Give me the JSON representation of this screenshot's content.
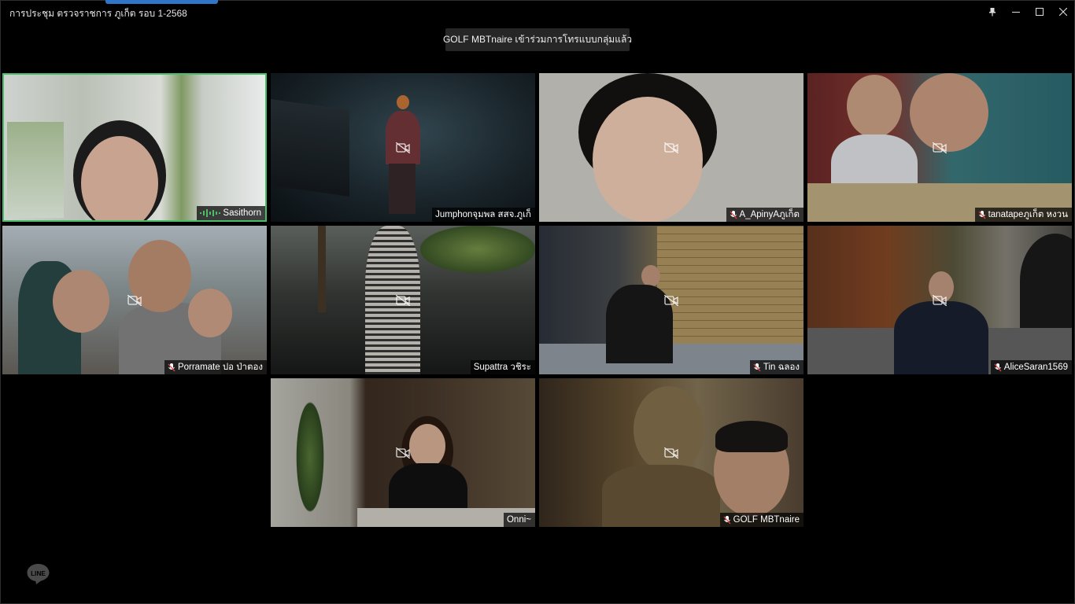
{
  "window": {
    "title": "การประชุม ตรวจราชการ ภูเก็ต รอบ 1-2568",
    "controls": [
      "pin-icon",
      "minimize-icon",
      "maximize-icon",
      "close-icon"
    ]
  },
  "notification": {
    "text": "GOLF MBTnaire เข้าร่วมการโทรแบบกลุ่มแล้ว"
  },
  "participants": [
    {
      "name": "Sasithorn",
      "speaking": true,
      "muted": false,
      "camera_icon": false
    },
    {
      "name": "Jumphonจุมพล สสจ.ภูเก็",
      "speaking": false,
      "muted": false,
      "camera_icon": true
    },
    {
      "name": "A_ApinyAภูเก็ต",
      "speaking": false,
      "muted": true,
      "camera_icon": true
    },
    {
      "name": "tanatapeภูเก็ต หงวน",
      "speaking": false,
      "muted": true,
      "camera_icon": true
    },
    {
      "name": "Porramate ปอ ป่าตอง",
      "speaking": false,
      "muted": true,
      "camera_icon": true
    },
    {
      "name": "Supattra วชิระ",
      "speaking": false,
      "muted": false,
      "camera_icon": true
    },
    {
      "name": "Tin ฉลอง",
      "speaking": false,
      "muted": true,
      "camera_icon": true
    },
    {
      "name": "AliceSaran1569",
      "speaking": false,
      "muted": true,
      "camera_icon": true
    },
    {
      "name": "Onni~",
      "speaking": false,
      "muted": false,
      "camera_icon": true
    },
    {
      "name": "GOLF MBTnaire",
      "speaking": false,
      "muted": true,
      "camera_icon": true
    }
  ],
  "branding": {
    "logo_text": "LINE"
  },
  "colors": {
    "active_speaker_border": "#4bbd6a",
    "accent": "#2f76c9",
    "background": "#000000"
  }
}
